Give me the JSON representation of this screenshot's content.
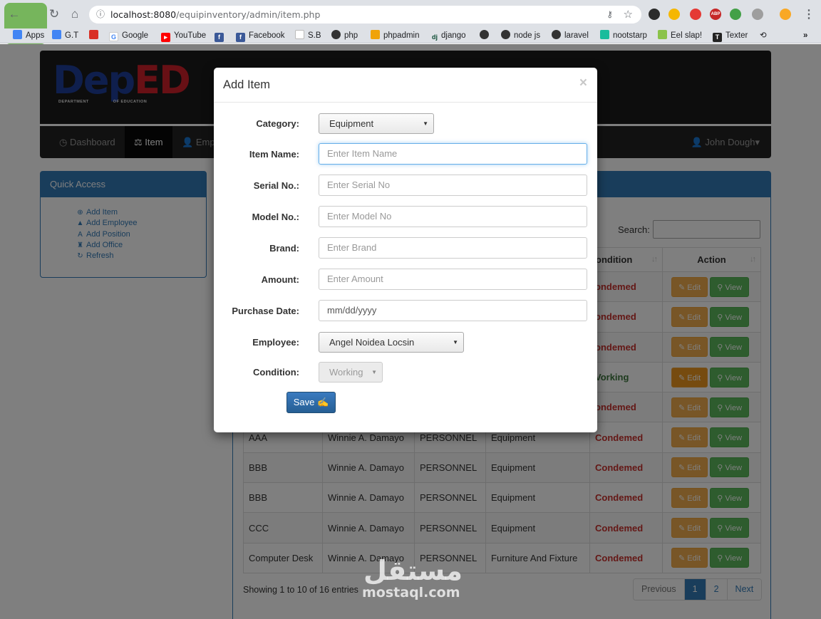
{
  "browser": {
    "url_host": "localhost:8080",
    "url_path": "/equipinventory/admin/item.php",
    "bookmarks": [
      "Apps",
      "G.T",
      "Google",
      "YouTube",
      "Facebook",
      "S.B",
      "php",
      "phpadmin",
      "django",
      "node js",
      "laravel",
      "nootstarp",
      "Eel slap!",
      "Texter"
    ],
    "more": "»",
    "ext_abp": "ABP"
  },
  "app": {
    "logo_dep": "Dep",
    "logo_ed": "ED",
    "logo_sub_left": "DEPARTMENT",
    "logo_sub_right": "OF EDUCATION",
    "nav": [
      "Dashboard",
      "Item",
      "Emp"
    ],
    "user": "John Dough"
  },
  "quick_access": {
    "title": "Quick Access",
    "items": [
      "Add Item",
      "Add Employee",
      "Add Position",
      "Add Office",
      "Refresh"
    ]
  },
  "table": {
    "search_label": "Search:",
    "headers": [
      "",
      "",
      "",
      "",
      "ondition",
      "Action"
    ],
    "edit_label": "Edit",
    "view_label": "View",
    "rows": [
      {
        "c1": "",
        "c2": "",
        "c3": "",
        "c4": "",
        "cond": "ondemed"
      },
      {
        "c1": "",
        "c2": "",
        "c3": "",
        "c4": "",
        "cond": "ondemed"
      },
      {
        "c1": "",
        "c2": "",
        "c3": "",
        "c4": "",
        "cond": "ondemed"
      },
      {
        "c1": "",
        "c2": "",
        "c3": "",
        "c4": "",
        "cond": "Vorking"
      },
      {
        "c1": "",
        "c2": "",
        "c3": "",
        "c4": "",
        "cond": "ondemed"
      },
      {
        "c1": "AAA",
        "c2": "Winnie A. Damayo",
        "c3": "PERSONNEL",
        "c4": "Equipment",
        "cond": "Condemed"
      },
      {
        "c1": "BBB",
        "c2": "Winnie A. Damayo",
        "c3": "PERSONNEL",
        "c4": "Equipment",
        "cond": "Condemed"
      },
      {
        "c1": "BBB",
        "c2": "Winnie A. Damayo",
        "c3": "PERSONNEL",
        "c4": "Equipment",
        "cond": "Condemed"
      },
      {
        "c1": "CCC",
        "c2": "Winnie A. Damayo",
        "c3": "PERSONNEL",
        "c4": "Equipment",
        "cond": "Condemed"
      },
      {
        "c1": "Computer Desk",
        "c2": "Winnie A. Damayo",
        "c3": "PERSONNEL",
        "c4": "Furniture And Fixture",
        "cond": "Condemed"
      }
    ],
    "info": "Showing 1 to 10 of 16 entries",
    "pager": [
      "Previous",
      "1",
      "2",
      "Next"
    ]
  },
  "modal": {
    "title": "Add Item",
    "close": "×",
    "category_label": "Category:",
    "category_value": "Equipment",
    "item_name_label": "Item Name:",
    "item_name_placeholder": "Enter Item Name",
    "serial_label": "Serial No.:",
    "serial_placeholder": "Enter Serial No",
    "model_label": "Model No.:",
    "model_placeholder": "Enter Model No",
    "brand_label": "Brand:",
    "brand_placeholder": "Enter Brand",
    "amount_label": "Amount:",
    "amount_placeholder": "Enter Amount",
    "date_label": "Purchase Date:",
    "date_placeholder": "mm/dd/yyyy",
    "employee_label": "Employee:",
    "employee_value": "Angel Noidea Locsin",
    "condition_label": "Condition:",
    "condition_value": "Working",
    "save_label": "Save"
  },
  "watermark": {
    "arabic": "مستقل",
    "latin": "mostaql.com"
  },
  "colors": {
    "primary": "#337ab7",
    "danger": "#c9302c",
    "success": "#5cb85c",
    "warning": "#f0ad4e"
  }
}
